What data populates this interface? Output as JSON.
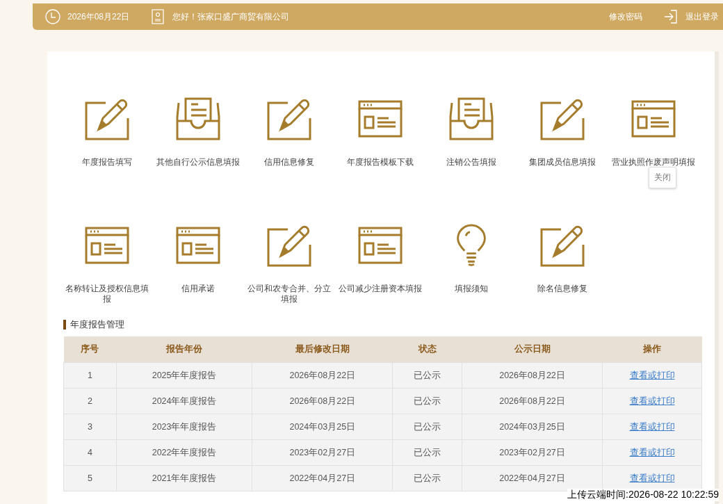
{
  "header": {
    "date": "2026年08月22日",
    "greeting": "您好！张家口盛广商贸有限公司",
    "change_password": "修改密码",
    "logout": "退出登录"
  },
  "functions": [
    {
      "label": "年度报告填写",
      "kind": "edit"
    },
    {
      "label": "其他自行公示信息填报",
      "kind": "inbox"
    },
    {
      "label": "信用信息修复",
      "kind": "edit"
    },
    {
      "label": "年度报告模板下载",
      "kind": "window"
    },
    {
      "label": "注销公告填报",
      "kind": "inbox"
    },
    {
      "label": "集团成员信息填报",
      "kind": "edit"
    },
    {
      "label": "营业执照作废声明填报",
      "kind": "window",
      "tooltip": "关闭"
    },
    {
      "label": "名称转让及授权信息填报",
      "kind": "window"
    },
    {
      "label": "信用承诺",
      "kind": "window"
    },
    {
      "label": "公司和农专合并、分立填报",
      "kind": "edit"
    },
    {
      "label": "公司减少注册资本填报",
      "kind": "window"
    },
    {
      "label": "填报须知",
      "kind": "bulb"
    },
    {
      "label": "除名信息修复",
      "kind": "edit"
    }
  ],
  "annual_reports": {
    "title": "年度报告管理",
    "columns": [
      "序号",
      "报告年份",
      "最后修改日期",
      "状态",
      "公示日期",
      "操作"
    ],
    "rows": [
      [
        "1",
        "2025年年度报告",
        "2026年08月22日",
        "已公示",
        "2026年08月22日",
        "查看或打印"
      ],
      [
        "2",
        "2024年年度报告",
        "2026年08月22日",
        "已公示",
        "2026年08月22日",
        "查看或打印"
      ],
      [
        "3",
        "2023年年度报告",
        "2024年03月25日",
        "已公示",
        "2024年03月25日",
        "查看或打印"
      ],
      [
        "4",
        "2022年年度报告",
        "2023年02月27日",
        "已公示",
        "2023年02月27日",
        "查看或打印"
      ],
      [
        "5",
        "2021年年度报告",
        "2022年04月27日",
        "已公示",
        "2022年04月27日",
        "查看或打印"
      ]
    ]
  },
  "upload_time_stamp": "上传云端时间:2026-08-22 10:22:59"
}
